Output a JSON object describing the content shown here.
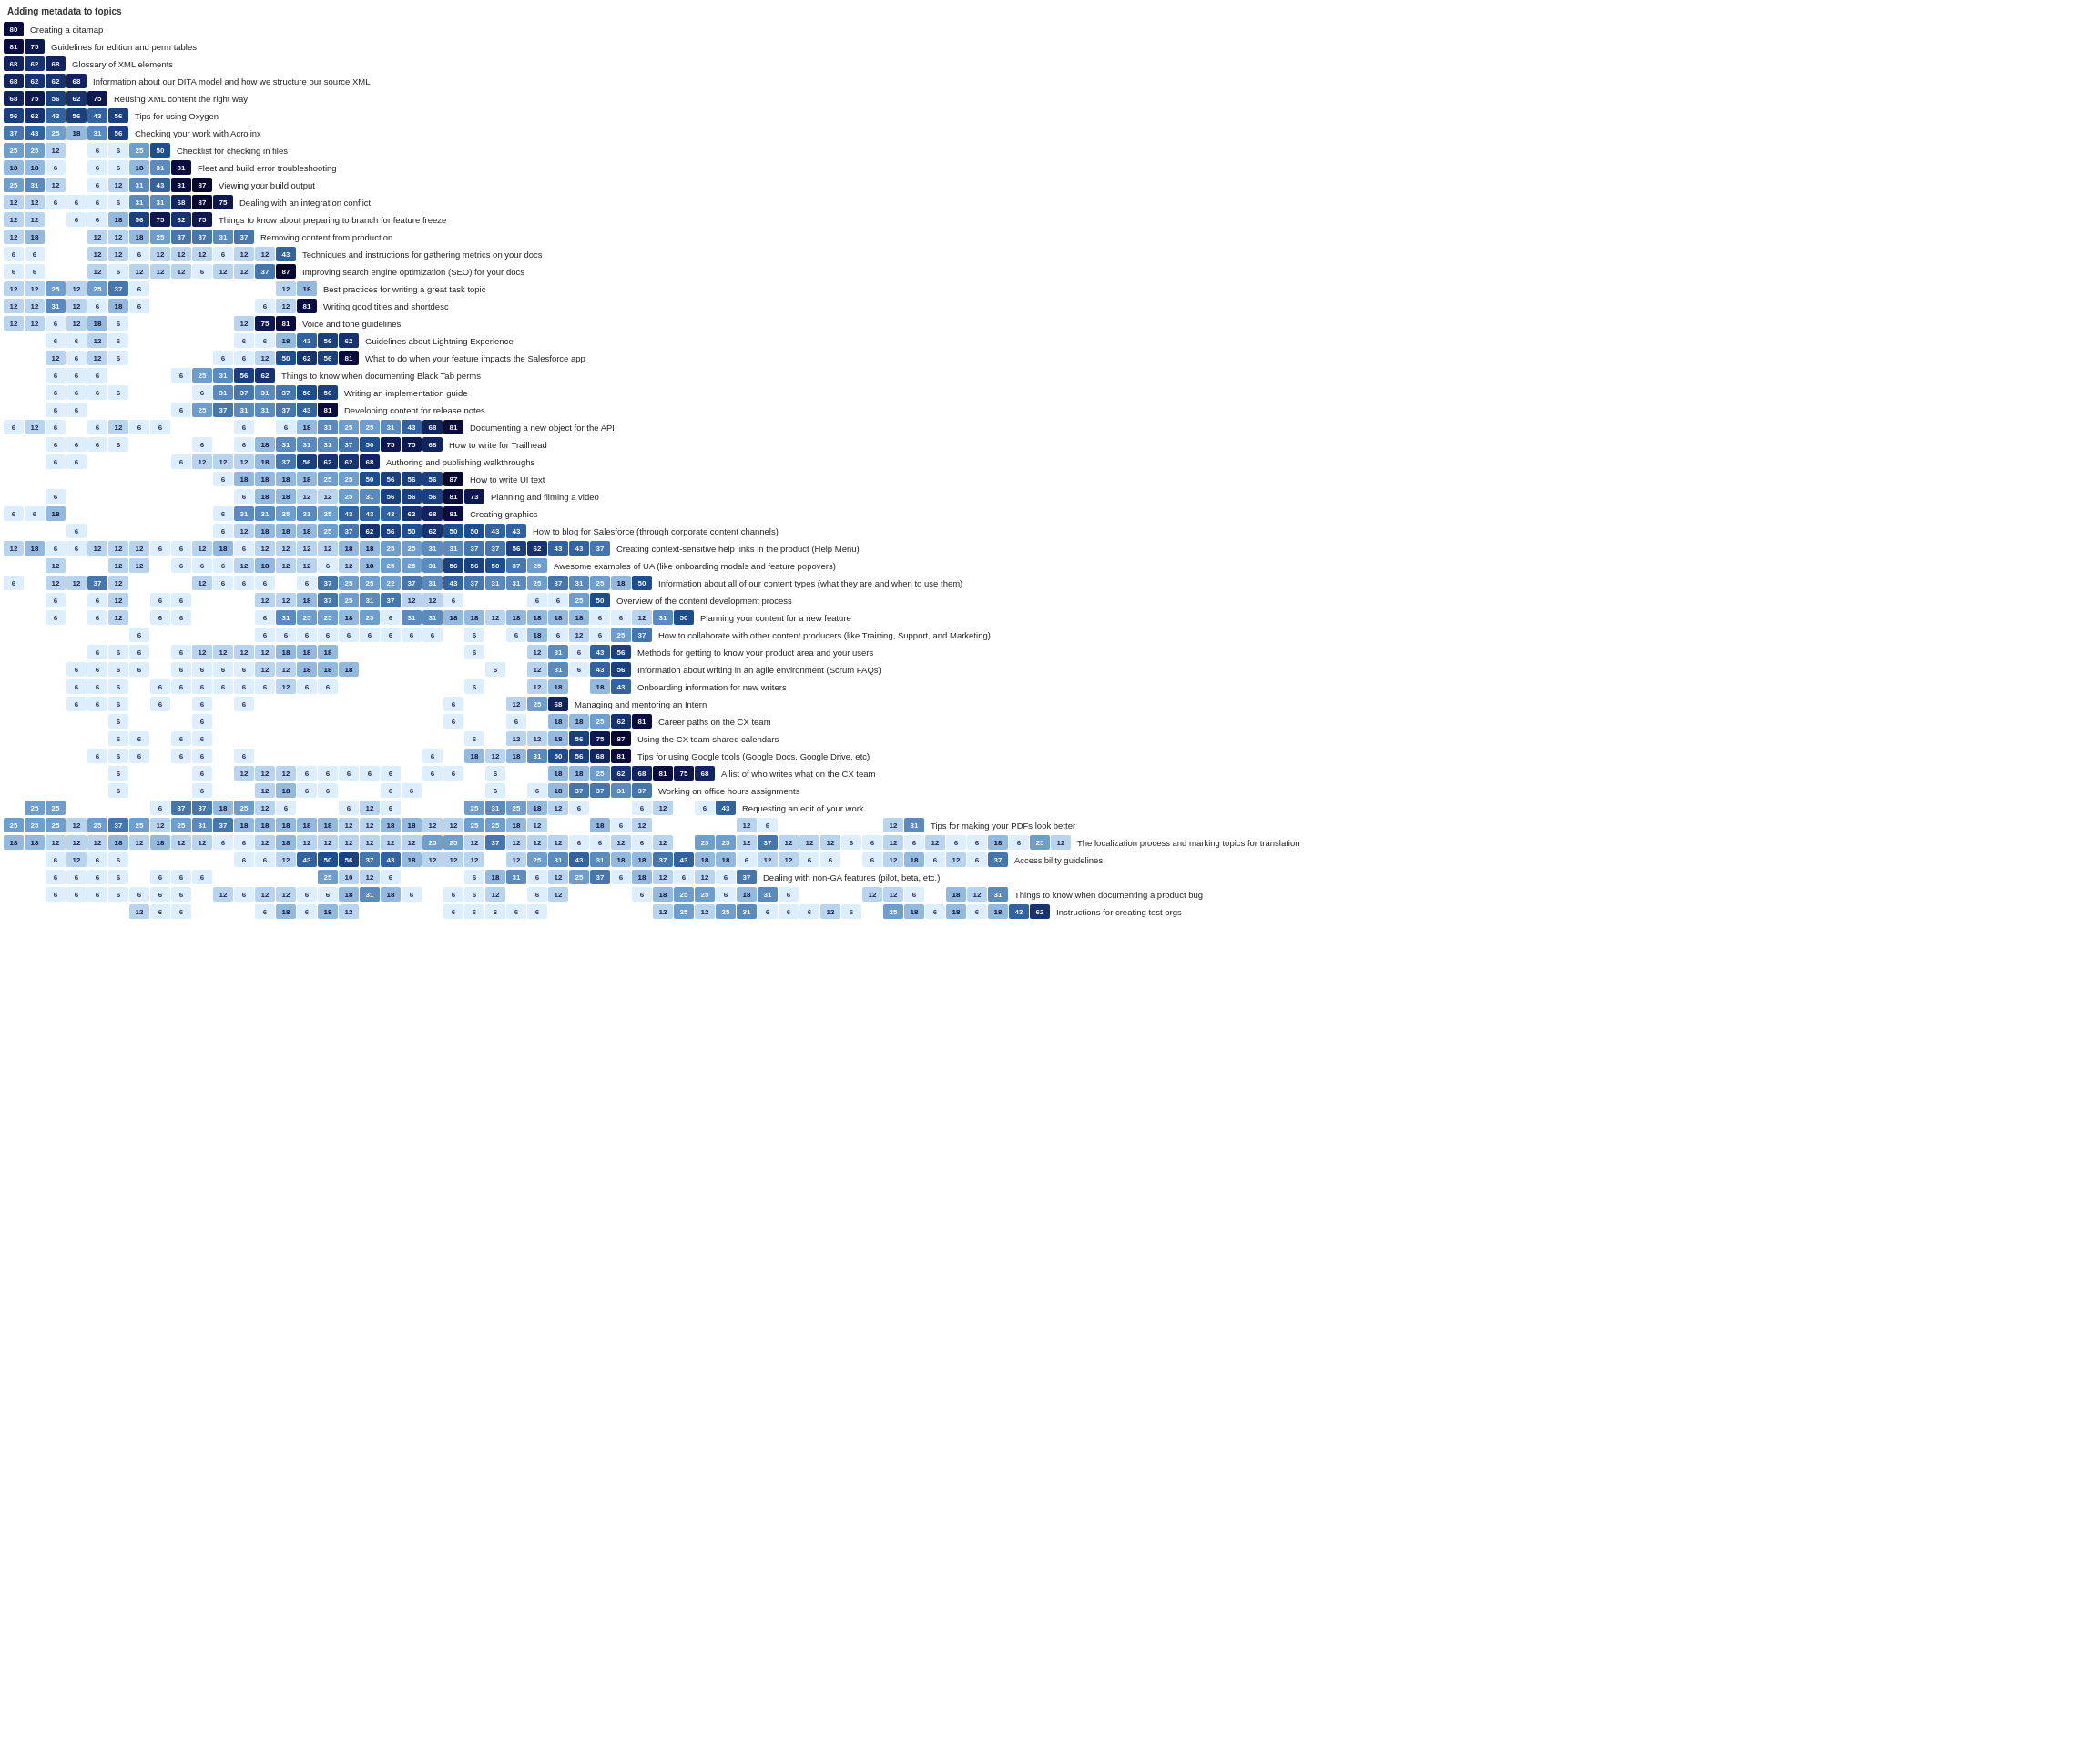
{
  "rows": [
    {
      "cells": [],
      "label": "Adding metadata to topics",
      "title": true
    },
    {
      "cells": [
        80
      ],
      "label": "Creating a ditamap"
    },
    {
      "cells": [
        81,
        75
      ],
      "label": "Guidelines for edition and perm tables"
    },
    {
      "cells": [
        68,
        62,
        68
      ],
      "label": "Glossary of XML elements"
    },
    {
      "cells": [
        68,
        62,
        62,
        68
      ],
      "label": "Information about our DITA model and how we structure our source XML"
    },
    {
      "cells": [
        68,
        75,
        56,
        62,
        75
      ],
      "label": "Reusing XML content the right way"
    },
    {
      "cells": [
        56,
        62,
        43,
        56,
        43,
        56
      ],
      "label": "Tips for using Oxygen"
    },
    {
      "cells": [
        37,
        43,
        25,
        18,
        31,
        56
      ],
      "label": "Checking your work with Acrolinx"
    },
    {
      "cells": [
        25,
        25,
        12,
        0,
        6,
        6,
        25,
        50
      ],
      "label": "Checklist for checking in files"
    },
    {
      "cells": [
        18,
        18,
        6,
        0,
        6,
        6,
        18,
        31,
        81
      ],
      "label": "Fleet and build error troubleshooting"
    },
    {
      "cells": [
        25,
        31,
        12,
        0,
        6,
        12,
        31,
        43,
        81,
        87
      ],
      "label": "Viewing your build output"
    },
    {
      "cells": [
        12,
        12,
        6,
        6,
        6,
        6,
        31,
        31,
        68,
        87,
        75
      ],
      "label": "Dealing with an integration conflict"
    },
    {
      "cells": [
        12,
        12,
        0,
        6,
        6,
        18,
        56,
        75,
        62,
        75
      ],
      "label": "Things to know about preparing to branch for feature freeze"
    },
    {
      "cells": [
        12,
        18,
        0,
        0,
        12,
        12,
        18,
        25,
        37,
        37,
        31,
        37
      ],
      "label": "Removing content from production"
    },
    {
      "cells": [
        6,
        6,
        0,
        0,
        12,
        12,
        6,
        12,
        12,
        12,
        6,
        12,
        12,
        43
      ],
      "label": "Techniques and instructions for gathering metrics on your docs"
    },
    {
      "cells": [
        6,
        6,
        0,
        0,
        12,
        6,
        12,
        12,
        12,
        6,
        12,
        12,
        37,
        87
      ],
      "label": "Improving search engine optimization (SEO) for your docs"
    },
    {
      "cells": [
        12,
        12,
        25,
        12,
        25,
        37,
        6,
        0,
        0,
        0,
        0,
        0,
        0,
        12,
        18
      ],
      "label": "Best practices for writing a great task topic"
    },
    {
      "cells": [
        12,
        12,
        31,
        12,
        6,
        18,
        6,
        0,
        0,
        0,
        0,
        0,
        6,
        12,
        81
      ],
      "label": "Writing good titles and shortdesc"
    },
    {
      "cells": [
        12,
        12,
        6,
        12,
        18,
        6,
        0,
        0,
        0,
        0,
        0,
        12,
        75,
        81
      ],
      "label": "Voice and tone guidelines"
    },
    {
      "cells": [
        0,
        0,
        6,
        6,
        12,
        6,
        0,
        0,
        0,
        0,
        0,
        6,
        6,
        18,
        43,
        56,
        62
      ],
      "label": "Guidelines about Lightning Experience"
    },
    {
      "cells": [
        0,
        0,
        12,
        6,
        12,
        6,
        0,
        0,
        0,
        0,
        6,
        6,
        12,
        50,
        62,
        56,
        81
      ],
      "label": "What to do when your feature impacts the Salesforce app"
    },
    {
      "cells": [
        0,
        0,
        6,
        6,
        6,
        0,
        0,
        0,
        6,
        25,
        31,
        56,
        62
      ],
      "label": "Things to know when documenting Black Tab perms"
    },
    {
      "cells": [
        0,
        0,
        6,
        6,
        6,
        6,
        0,
        0,
        0,
        6,
        31,
        37,
        31,
        37,
        50,
        56
      ],
      "label": "Writing an implementation guide"
    },
    {
      "cells": [
        0,
        0,
        6,
        6,
        0,
        0,
        0,
        0,
        6,
        25,
        37,
        31,
        31,
        37,
        43,
        81
      ],
      "label": "Developing content for release notes"
    },
    {
      "cells": [
        6,
        12,
        6,
        0,
        6,
        12,
        6,
        6,
        0,
        0,
        0,
        6,
        0,
        6,
        18,
        31,
        25,
        25,
        31,
        43,
        68,
        81
      ],
      "label": "Documenting a new object for the API"
    },
    {
      "cells": [
        0,
        0,
        6,
        6,
        6,
        6,
        0,
        0,
        0,
        6,
        0,
        6,
        18,
        31,
        31,
        31,
        37,
        50,
        75,
        75,
        68
      ],
      "label": "How to write for Trailhead"
    },
    {
      "cells": [
        0,
        0,
        6,
        6,
        0,
        0,
        0,
        0,
        6,
        12,
        12,
        12,
        18,
        37,
        56,
        62,
        62,
        68
      ],
      "label": "Authoring and publishing walkthroughs"
    },
    {
      "cells": [
        0,
        0,
        0,
        0,
        0,
        0,
        0,
        0,
        0,
        0,
        6,
        18,
        18,
        18,
        18,
        25,
        25,
        50,
        56,
        56,
        56,
        87
      ],
      "label": "How to write UI text"
    },
    {
      "cells": [
        0,
        0,
        6,
        0,
        0,
        0,
        0,
        0,
        0,
        0,
        0,
        6,
        18,
        18,
        12,
        12,
        25,
        31,
        56,
        56,
        56,
        81,
        73
      ],
      "label": "Planning and filming a video"
    },
    {
      "cells": [
        6,
        6,
        18,
        0,
        0,
        0,
        0,
        0,
        0,
        0,
        6,
        31,
        31,
        25,
        31,
        25,
        43,
        43,
        43,
        62,
        68,
        81
      ],
      "label": "Creating graphics"
    },
    {
      "cells": [
        0,
        0,
        0,
        6,
        0,
        0,
        0,
        0,
        0,
        0,
        6,
        12,
        18,
        18,
        18,
        25,
        37,
        62,
        56,
        50,
        62,
        50,
        50,
        43,
        43
      ],
      "label": "How to blog for Salesforce (through corporate content channels)"
    },
    {
      "cells": [
        12,
        18,
        6,
        6,
        12,
        12,
        12,
        6,
        6,
        12,
        18,
        6,
        12,
        12,
        12,
        12,
        18,
        18,
        25,
        25,
        31,
        31,
        37,
        37,
        56,
        62,
        43,
        43,
        37
      ],
      "label": "Creating context-sensitive help links in the product (Help Menu)"
    },
    {
      "cells": [
        0,
        0,
        12,
        0,
        0,
        12,
        12,
        0,
        6,
        6,
        6,
        12,
        18,
        12,
        12,
        6,
        12,
        18,
        25,
        25,
        31,
        56,
        56,
        50,
        37,
        25
      ],
      "label": "Awesome examples of UA (like onboarding modals and feature popovers)"
    },
    {
      "cells": [
        6,
        0,
        12,
        12,
        37,
        12,
        0,
        0,
        0,
        12,
        6,
        6,
        6,
        0,
        6,
        37,
        25,
        25,
        22,
        37,
        31,
        43,
        37,
        31,
        31,
        25,
        37,
        31,
        25,
        18,
        50
      ],
      "label": "Information about all of our content types (what they are and when to use them)"
    },
    {
      "cells": [
        0,
        0,
        6,
        0,
        6,
        12,
        0,
        6,
        6,
        0,
        0,
        0,
        12,
        12,
        18,
        37,
        25,
        31,
        37,
        12,
        12,
        6,
        0,
        0,
        0,
        6,
        6,
        25,
        50
      ],
      "label": "Overview of the content development process"
    },
    {
      "cells": [
        0,
        0,
        6,
        0,
        6,
        12,
        0,
        6,
        6,
        0,
        0,
        0,
        6,
        31,
        25,
        25,
        18,
        25,
        6,
        31,
        31,
        18,
        18,
        12,
        18,
        18,
        18,
        18,
        6,
        6,
        12,
        31,
        50
      ],
      "label": "Planning your content for a new feature"
    },
    {
      "cells": [
        0,
        0,
        0,
        0,
        0,
        0,
        6,
        0,
        0,
        0,
        0,
        0,
        6,
        6,
        6,
        6,
        6,
        6,
        6,
        6,
        6,
        0,
        6,
        0,
        6,
        18,
        6,
        12,
        6,
        25,
        37
      ],
      "label": "How to collaborate with other content producers (like Training, Support, and Marketing)"
    },
    {
      "cells": [
        0,
        0,
        0,
        0,
        6,
        6,
        6,
        0,
        6,
        12,
        12,
        12,
        12,
        18,
        18,
        18,
        0,
        0,
        0,
        0,
        0,
        0,
        6,
        0,
        0,
        12,
        31,
        6,
        43,
        56
      ],
      "label": "Methods for getting to know your product area and your users"
    },
    {
      "cells": [
        0,
        0,
        0,
        6,
        6,
        6,
        6,
        0,
        6,
        6,
        6,
        6,
        12,
        12,
        18,
        18,
        18,
        0,
        0,
        0,
        0,
        0,
        0,
        6,
        0,
        12,
        31,
        6,
        43,
        56
      ],
      "label": "Information about writing in an agile environment (Scrum FAQs)"
    },
    {
      "cells": [
        0,
        0,
        0,
        6,
        6,
        6,
        0,
        6,
        6,
        6,
        6,
        6,
        6,
        12,
        6,
        6,
        0,
        0,
        0,
        0,
        0,
        0,
        6,
        0,
        0,
        12,
        18,
        0,
        18,
        43
      ],
      "label": "Onboarding information for new writers"
    },
    {
      "cells": [
        0,
        0,
        0,
        6,
        6,
        6,
        0,
        6,
        0,
        6,
        0,
        6,
        0,
        0,
        0,
        0,
        0,
        0,
        0,
        0,
        0,
        6,
        0,
        0,
        12,
        25,
        68
      ],
      "label": "Managing and mentoring an Intern"
    },
    {
      "cells": [
        0,
        0,
        0,
        0,
        0,
        6,
        0,
        0,
        0,
        6,
        0,
        0,
        0,
        0,
        0,
        0,
        0,
        0,
        0,
        0,
        0,
        6,
        0,
        0,
        6,
        0,
        18,
        18,
        25,
        62,
        81
      ],
      "label": "Career paths on the CX team"
    },
    {
      "cells": [
        0,
        0,
        0,
        0,
        0,
        6,
        6,
        0,
        6,
        6,
        0,
        0,
        0,
        0,
        0,
        0,
        0,
        0,
        0,
        0,
        0,
        0,
        6,
        0,
        12,
        12,
        18,
        56,
        75,
        87
      ],
      "label": "Using the CX team shared calendars"
    },
    {
      "cells": [
        0,
        0,
        0,
        0,
        6,
        6,
        6,
        0,
        6,
        6,
        0,
        6,
        0,
        0,
        0,
        0,
        0,
        0,
        0,
        0,
        6,
        0,
        18,
        12,
        18,
        31,
        50,
        56,
        68,
        81
      ],
      "label": "Tips for using Google tools (Google Docs, Google Drive, etc)"
    },
    {
      "cells": [
        0,
        0,
        0,
        0,
        0,
        6,
        0,
        0,
        0,
        6,
        0,
        12,
        12,
        12,
        6,
        6,
        6,
        6,
        6,
        0,
        6,
        6,
        0,
        6,
        0,
        0,
        18,
        18,
        25,
        62,
        68,
        81,
        75,
        68
      ],
      "label": "A list of who writes what on the CX team"
    },
    {
      "cells": [
        0,
        0,
        0,
        0,
        0,
        6,
        0,
        0,
        0,
        6,
        0,
        0,
        12,
        18,
        6,
        6,
        0,
        0,
        6,
        6,
        0,
        0,
        0,
        6,
        0,
        6,
        18,
        37,
        37,
        31,
        37
      ],
      "label": "Working on office hours assignments"
    },
    {
      "cells": [
        0,
        25,
        25,
        0,
        0,
        0,
        0,
        6,
        37,
        37,
        18,
        25,
        12,
        6,
        0,
        0,
        6,
        12,
        6,
        0,
        0,
        0,
        25,
        31,
        25,
        18,
        12,
        6,
        0,
        0,
        6,
        12,
        0,
        6,
        43
      ],
      "label": "Requesting an edit of your work"
    },
    {
      "cells": [
        25,
        25,
        25,
        12,
        25,
        37,
        25,
        12,
        25,
        31,
        37,
        18,
        18,
        18,
        18,
        18,
        12,
        12,
        18,
        18,
        12,
        12,
        25,
        25,
        18,
        12,
        0,
        0,
        18,
        6,
        12,
        0,
        0,
        0,
        0,
        12,
        6,
        0,
        0,
        0,
        0,
        0,
        12,
        31
      ],
      "label": "Tips for making your PDFs look better"
    },
    {
      "cells": [
        18,
        18,
        12,
        12,
        12,
        18,
        12,
        18,
        12,
        12,
        6,
        6,
        12,
        18,
        12,
        12,
        12,
        12,
        12,
        12,
        25,
        25,
        12,
        37,
        12,
        12,
        12,
        6,
        6,
        12,
        6,
        12,
        0,
        25,
        25,
        12,
        37,
        12,
        12,
        12,
        6,
        6,
        12,
        6,
        12,
        6,
        6,
        18,
        6,
        25,
        12
      ],
      "label": "The localization process and marking topics for translation"
    },
    {
      "cells": [
        0,
        0,
        6,
        12,
        6,
        6,
        0,
        0,
        0,
        0,
        0,
        6,
        6,
        12,
        43,
        50,
        56,
        37,
        43,
        18,
        12,
        12,
        12,
        0,
        12,
        25,
        31,
        43,
        31,
        18,
        18,
        37,
        43,
        18,
        18,
        6,
        12,
        12,
        6,
        6,
        0,
        6,
        12,
        18,
        6,
        12,
        6,
        37
      ],
      "label": "Accessibility guidelines"
    },
    {
      "cells": [
        0,
        0,
        6,
        6,
        6,
        6,
        0,
        6,
        6,
        6,
        0,
        0,
        0,
        0,
        0,
        25,
        10,
        12,
        6,
        0,
        0,
        0,
        6,
        18,
        31,
        6,
        12,
        25,
        37,
        6,
        18,
        12,
        6,
        12,
        6,
        37
      ],
      "label": "Dealing with non-GA features (pilot, beta, etc.)"
    },
    {
      "cells": [
        0,
        0,
        6,
        6,
        6,
        6,
        6,
        6,
        6,
        0,
        12,
        6,
        12,
        12,
        6,
        6,
        18,
        31,
        18,
        6,
        0,
        6,
        6,
        12,
        0,
        6,
        12,
        0,
        0,
        0,
        6,
        18,
        25,
        25,
        6,
        18,
        31,
        6,
        0,
        0,
        0,
        12,
        12,
        6,
        0,
        18,
        12,
        31
      ],
      "label": "Things to know when documenting a product bug"
    },
    {
      "cells": [
        0,
        0,
        0,
        0,
        0,
        0,
        12,
        6,
        6,
        0,
        0,
        0,
        6,
        18,
        6,
        18,
        12,
        0,
        0,
        0,
        0,
        6,
        6,
        6,
        6,
        6,
        0,
        0,
        0,
        0,
        0,
        12,
        25,
        12,
        25,
        31,
        6,
        6,
        6,
        12,
        6,
        0,
        25,
        18,
        6,
        18,
        6,
        18,
        43,
        62
      ],
      "label": "Instructions for creating test orgs"
    }
  ]
}
